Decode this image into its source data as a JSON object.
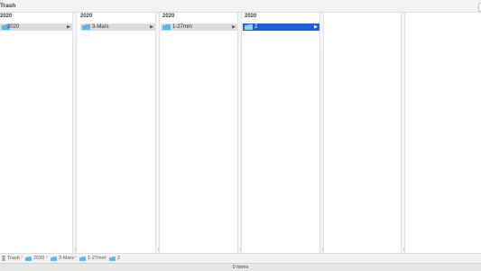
{
  "window": {
    "title": "Trash"
  },
  "columns": [
    {
      "header": "2020",
      "item": "2020",
      "selected": false
    },
    {
      "header": "2020",
      "item": "3-Mars",
      "selected": false
    },
    {
      "header": "2020",
      "item": "1-27mm",
      "selected": false
    },
    {
      "header": "2020",
      "item": "2",
      "selected": true
    }
  ],
  "breadcrumb": [
    "Trash",
    "2020",
    "3-Mars",
    "1-27mm",
    "2"
  ],
  "status": {
    "items_label": "0 items"
  },
  "colors": {
    "selection": "#1b5fd8",
    "folder": "#5ab4e8"
  },
  "icons": [
    "trash-icon",
    "folder-icon",
    "chevron-right-icon"
  ]
}
